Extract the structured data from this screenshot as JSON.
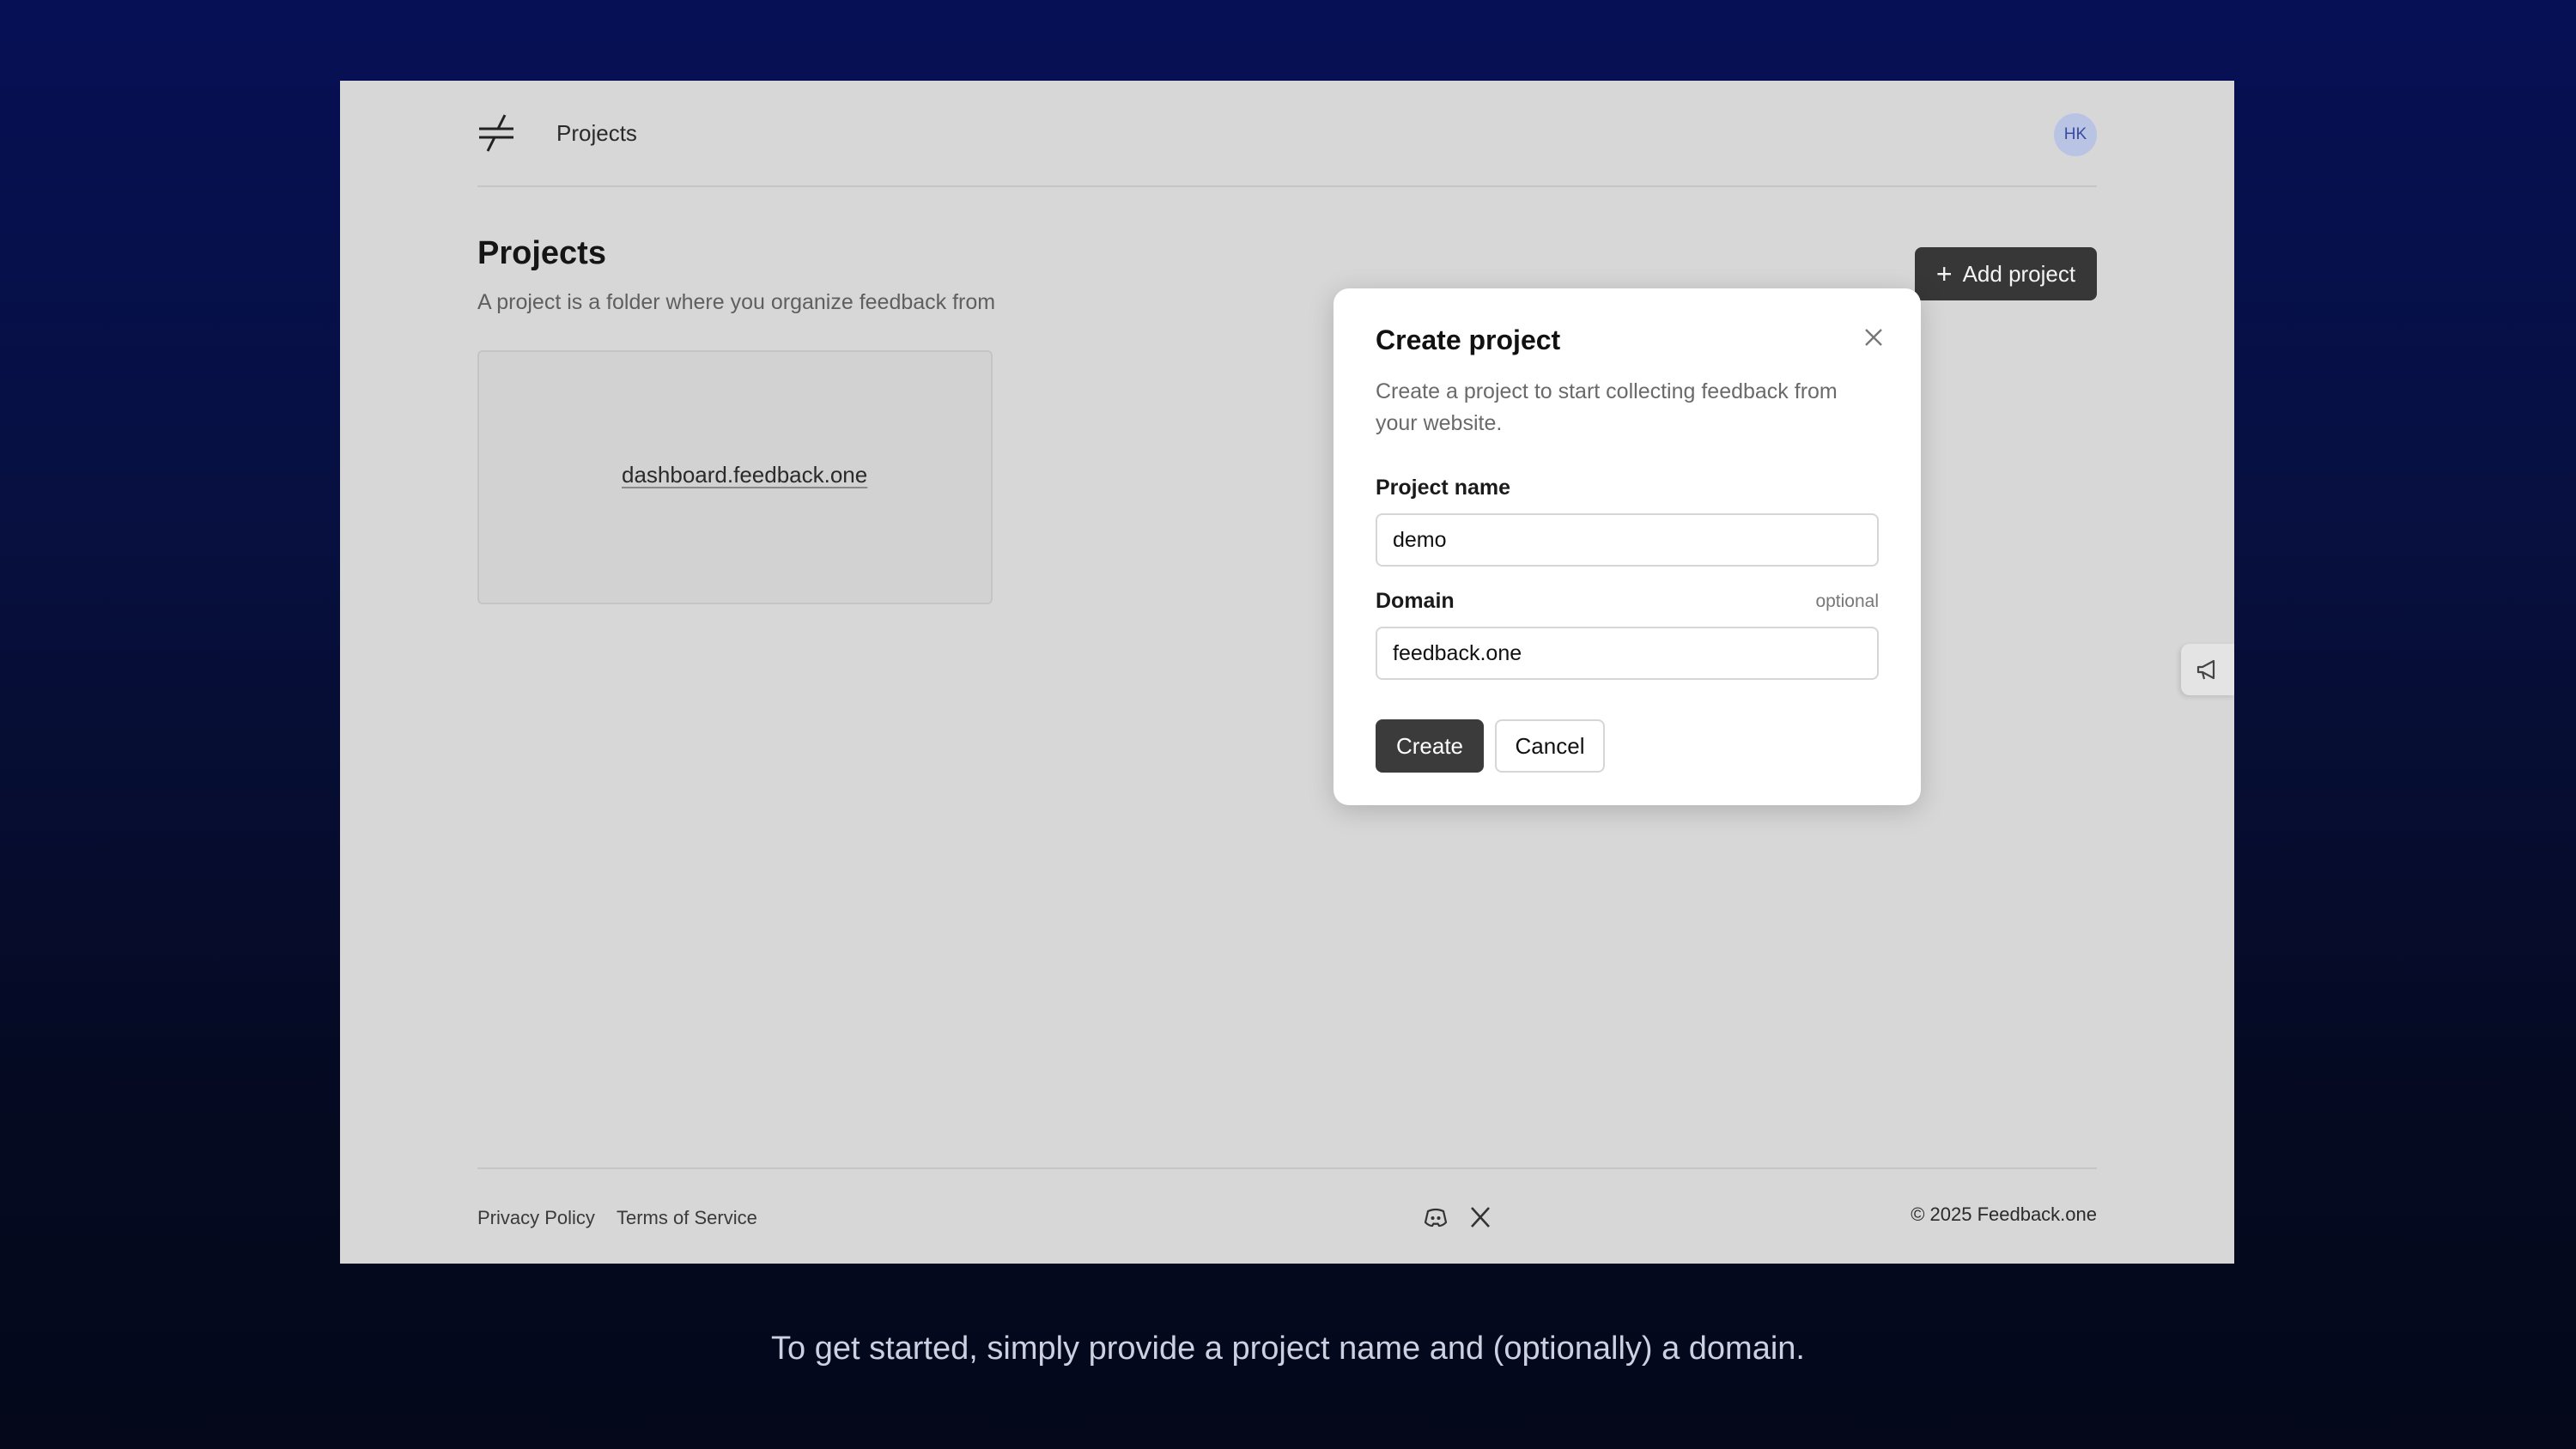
{
  "header": {
    "nav_label": "Projects",
    "avatar_initials": "HK"
  },
  "page": {
    "title": "Projects",
    "description": "A project is a folder where you organize feedback from",
    "add_button_label": "Add project"
  },
  "projects": [
    {
      "domain": "dashboard.feedback.one"
    }
  ],
  "footer": {
    "privacy": "Privacy Policy",
    "terms": "Terms of Service",
    "copyright": "© 2025 Feedback.one",
    "social_icons": [
      "discord-icon",
      "x-icon"
    ]
  },
  "modal": {
    "title": "Create project",
    "description": "Create a project to start collecting feedback from your website.",
    "name_label": "Project name",
    "name_value": "demo",
    "domain_label": "Domain",
    "domain_optional": "optional",
    "domain_value": "feedback.one",
    "create_label": "Create",
    "cancel_label": "Cancel"
  },
  "caption": "To get started, simply provide a project name and (optionally) a domain.",
  "colors": {
    "primary_button": "#373737",
    "avatar_bg": "#b9c4e4",
    "background": "#061055"
  }
}
